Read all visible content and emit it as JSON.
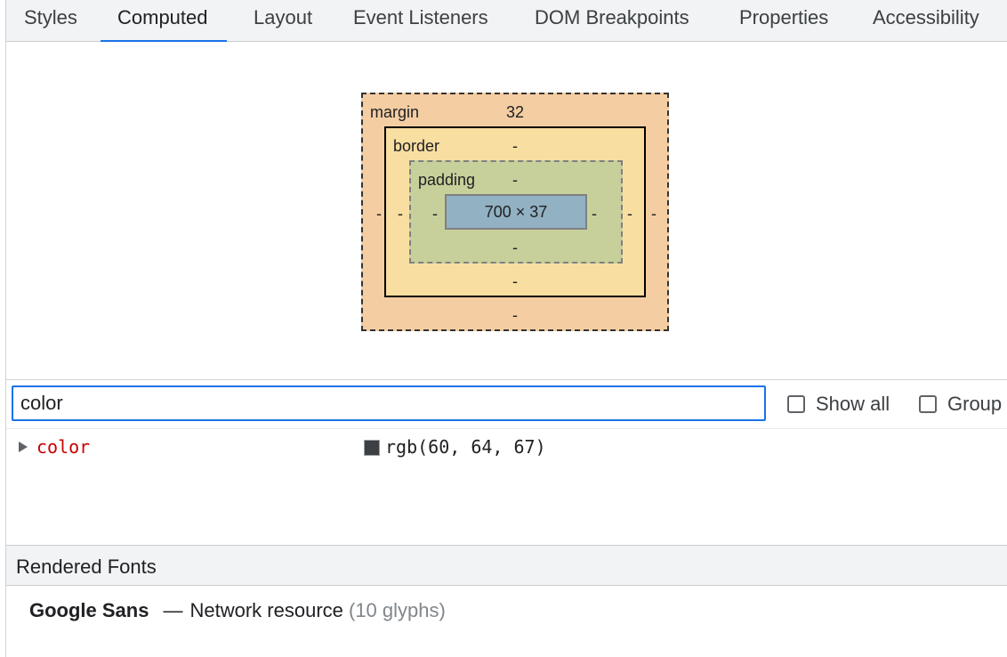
{
  "tabs": [
    {
      "label": "Styles",
      "active": false
    },
    {
      "label": "Computed",
      "active": true
    },
    {
      "label": "Layout",
      "active": false
    },
    {
      "label": "Event Listeners",
      "active": false
    },
    {
      "label": "DOM Breakpoints",
      "active": false
    },
    {
      "label": "Properties",
      "active": false
    },
    {
      "label": "Accessibility",
      "active": false
    }
  ],
  "box_model": {
    "margin": {
      "label": "margin",
      "top": "32",
      "right": "-",
      "bottom": "-",
      "left": "-"
    },
    "border": {
      "label": "border",
      "top": "-",
      "right": "-",
      "bottom": "-",
      "left": "-"
    },
    "padding": {
      "label": "padding",
      "top": "-",
      "right": "-",
      "bottom": "-",
      "left": "-"
    },
    "content": {
      "size": "700 × 37"
    }
  },
  "filter": {
    "value": "color",
    "show_all_label": "Show all",
    "group_label": "Group"
  },
  "computed_properties": [
    {
      "name": "color",
      "value": "rgb(60, 64, 67)",
      "swatch_color": "#3c4043"
    }
  ],
  "rendered_fonts": {
    "title": "Rendered Fonts",
    "items": [
      {
        "family": "Google Sans",
        "dash": "—",
        "source": "Network resource",
        "count": "(10 glyphs)"
      }
    ]
  },
  "colors": {
    "accent": "#1a73e8",
    "margin_bg": "#f4cda2",
    "border_bg": "#f9dea1",
    "padding_bg": "#c7d09a",
    "content_bg": "#92b1c2",
    "property_name": "#c80000"
  }
}
